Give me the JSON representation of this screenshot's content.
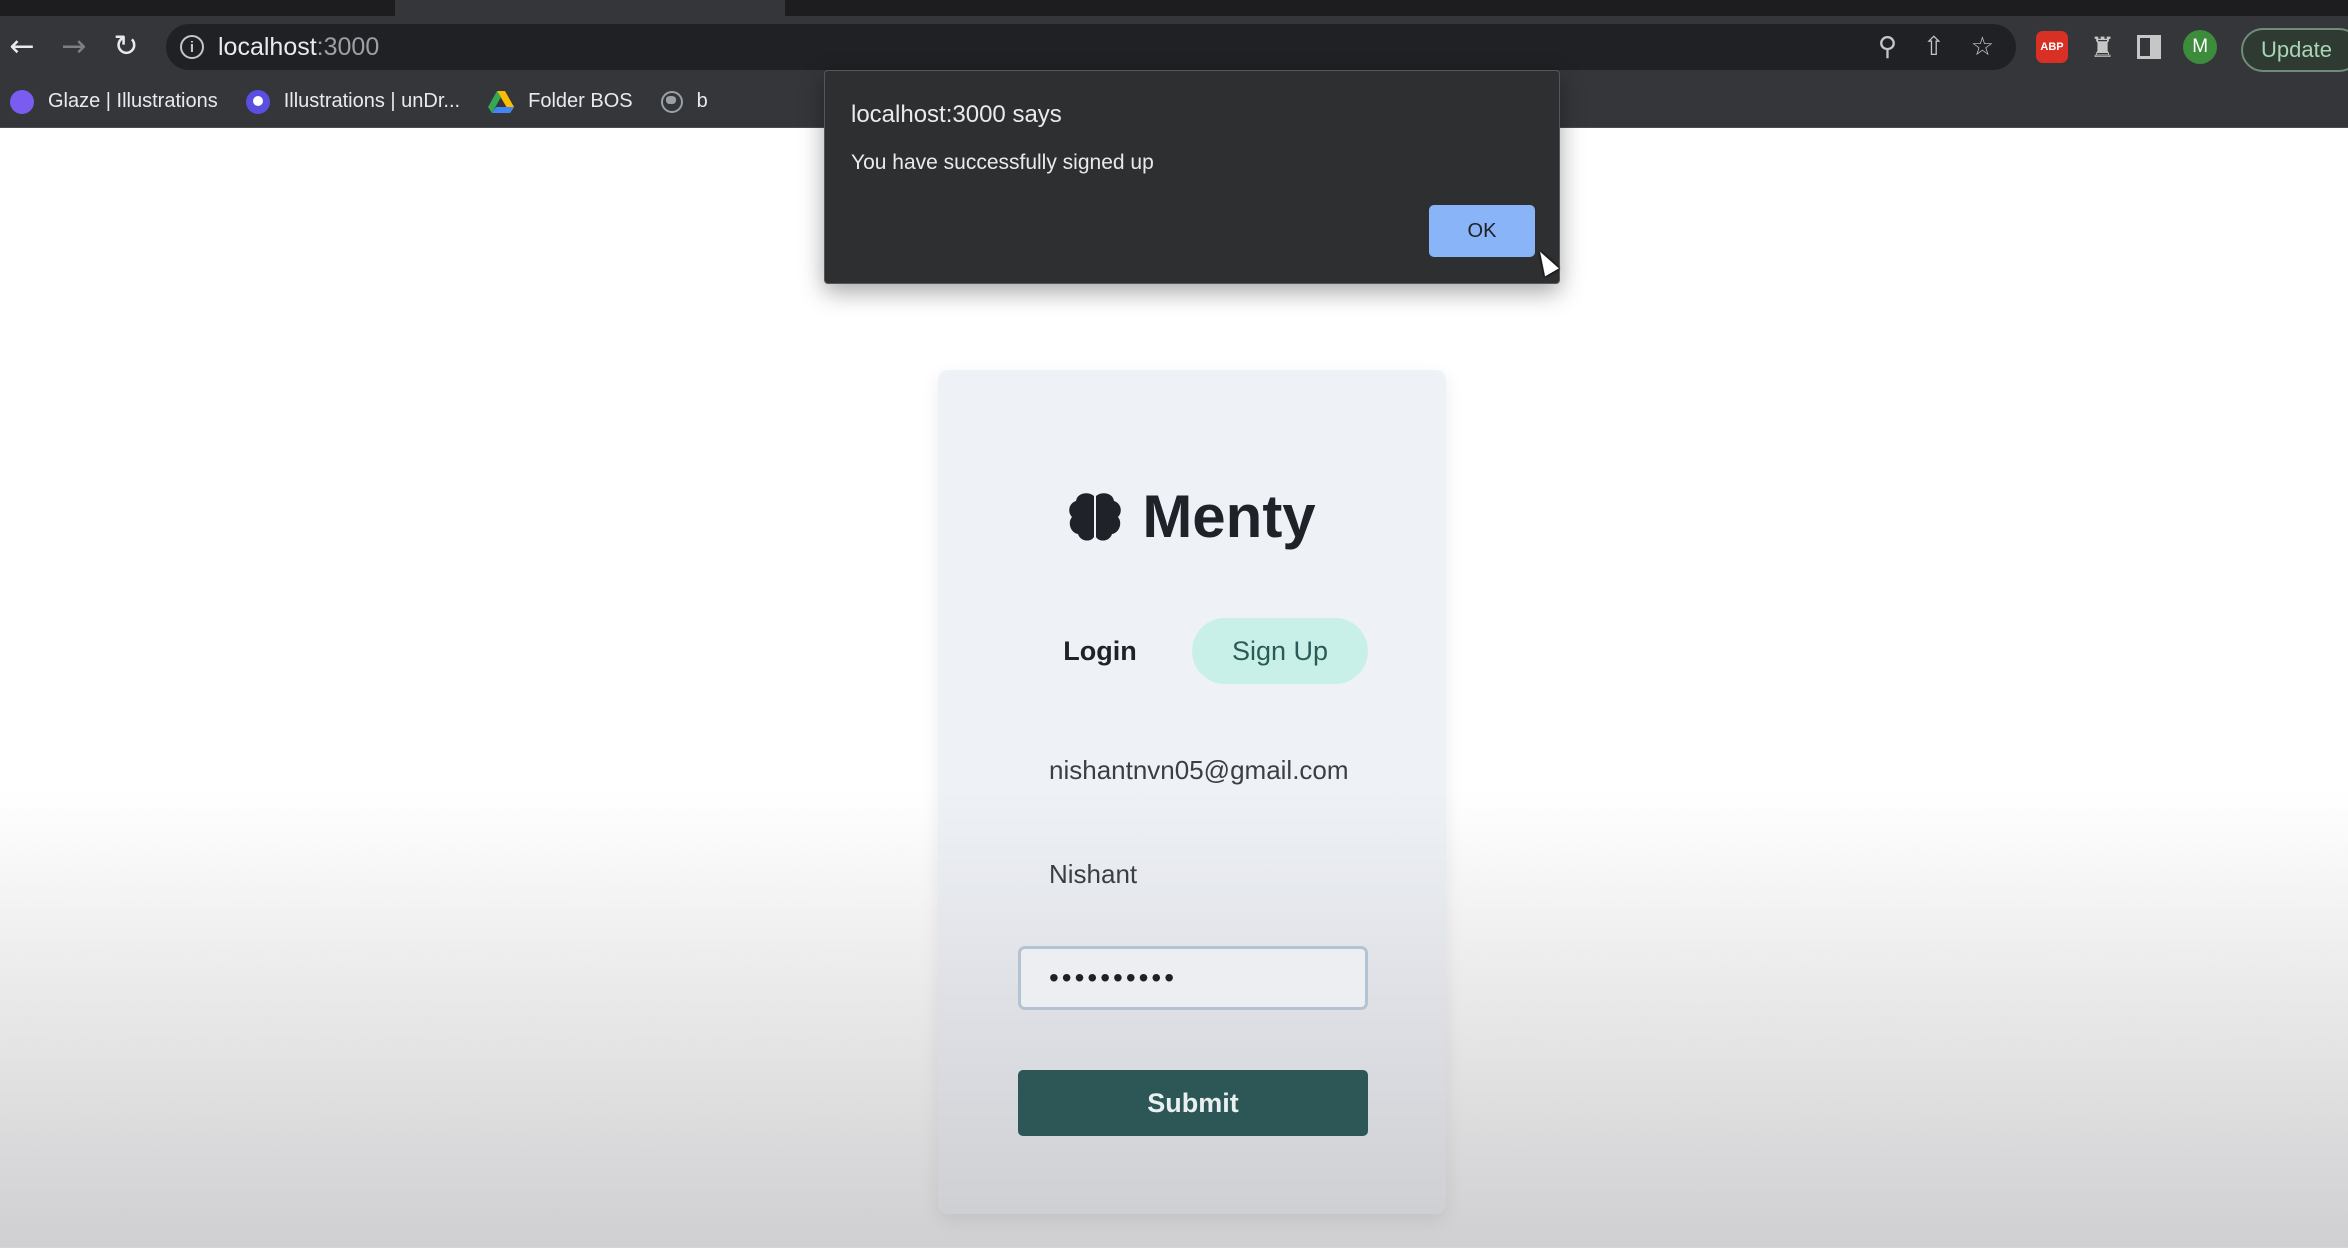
{
  "browser": {
    "url_host": "localhost",
    "url_port": ":3000",
    "update_label": "Update",
    "avatar_initial": "M",
    "abp_label": "ABP",
    "bookmarks": [
      {
        "label": "Glaze | Illustrations",
        "icon": "glaze-icon"
      },
      {
        "label": "Illustrations | unDr...",
        "icon": "undraw-icon"
      },
      {
        "label": "Folder BOS",
        "icon": "google-drive-icon"
      },
      {
        "label": "b",
        "icon": "globe-icon"
      }
    ]
  },
  "alert": {
    "title": "localhost:3000 says",
    "message": "You have successfully signed up",
    "ok_label": "OK"
  },
  "card": {
    "brand_name": "Menty",
    "tabs": {
      "login": "Login",
      "signup": "Sign Up",
      "active": "signup"
    },
    "email_value": "nishantnvn05@gmail.com",
    "name_value": "Nishant",
    "password_value": "••••••••••",
    "submit_label": "Submit"
  },
  "colors": {
    "accent_tab": "#c9f0e8",
    "submit_bg": "#2d5657",
    "alert_ok_bg": "#8ab4f8"
  }
}
